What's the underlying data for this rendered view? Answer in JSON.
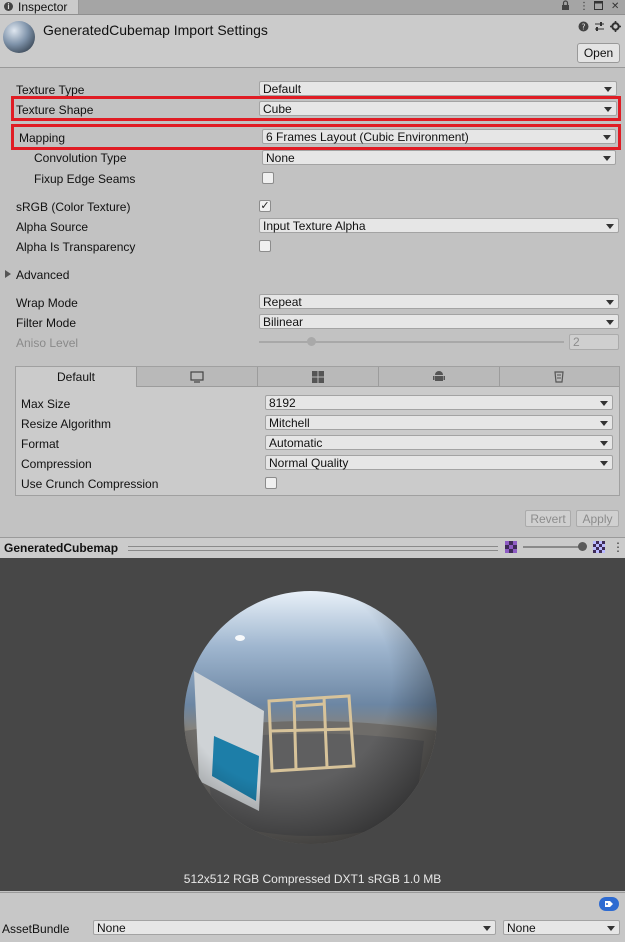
{
  "tab": {
    "label": "Inspector"
  },
  "header": {
    "title": "GeneratedCubemap Import Settings",
    "open_label": "Open"
  },
  "settings": {
    "texture_type": {
      "label": "Texture Type",
      "value": "Default"
    },
    "texture_shape": {
      "label": "Texture Shape",
      "value": "Cube"
    },
    "mapping": {
      "label": "Mapping",
      "value": "6 Frames Layout (Cubic Environment)"
    },
    "convolution_type": {
      "label": "Convolution Type",
      "value": "None"
    },
    "fixup_edge_seams": {
      "label": "Fixup Edge Seams",
      "checked": false
    },
    "srgb": {
      "label": "sRGB (Color Texture)",
      "checked": true
    },
    "alpha_source": {
      "label": "Alpha Source",
      "value": "Input Texture Alpha"
    },
    "alpha_is_transparency": {
      "label": "Alpha Is Transparency",
      "checked": false
    },
    "advanced": {
      "label": "Advanced"
    },
    "wrap_mode": {
      "label": "Wrap Mode",
      "value": "Repeat"
    },
    "filter_mode": {
      "label": "Filter Mode",
      "value": "Bilinear"
    },
    "aniso_level": {
      "label": "Aniso Level",
      "value": "2",
      "fraction": 0.17
    }
  },
  "platform": {
    "tabs": [
      {
        "label": "Default",
        "icon": ""
      },
      {
        "label": "",
        "icon": "monitor-icon"
      },
      {
        "label": "",
        "icon": "windows-store-icon"
      },
      {
        "label": "",
        "icon": "android-icon"
      },
      {
        "label": "",
        "icon": "webgl-icon"
      }
    ],
    "max_size": {
      "label": "Max Size",
      "value": "8192"
    },
    "resize_algorithm": {
      "label": "Resize Algorithm",
      "value": "Mitchell"
    },
    "format": {
      "label": "Format",
      "value": "Automatic"
    },
    "compression": {
      "label": "Compression",
      "value": "Normal Quality"
    },
    "use_crunch": {
      "label": "Use Crunch Compression",
      "checked": false
    }
  },
  "actions": {
    "revert": "Revert",
    "apply": "Apply"
  },
  "preview": {
    "title": "GeneratedCubemap",
    "info": "512x512  RGB Compressed DXT1 sRGB   1.0 MB",
    "mip_fraction": 0.96
  },
  "footer": {
    "assetbundle_label": "AssetBundle",
    "bundle_name": "None",
    "bundle_variant": "None"
  },
  "colors": {
    "highlight": "#e01c24",
    "tag_icon": "#2e6bd1"
  }
}
